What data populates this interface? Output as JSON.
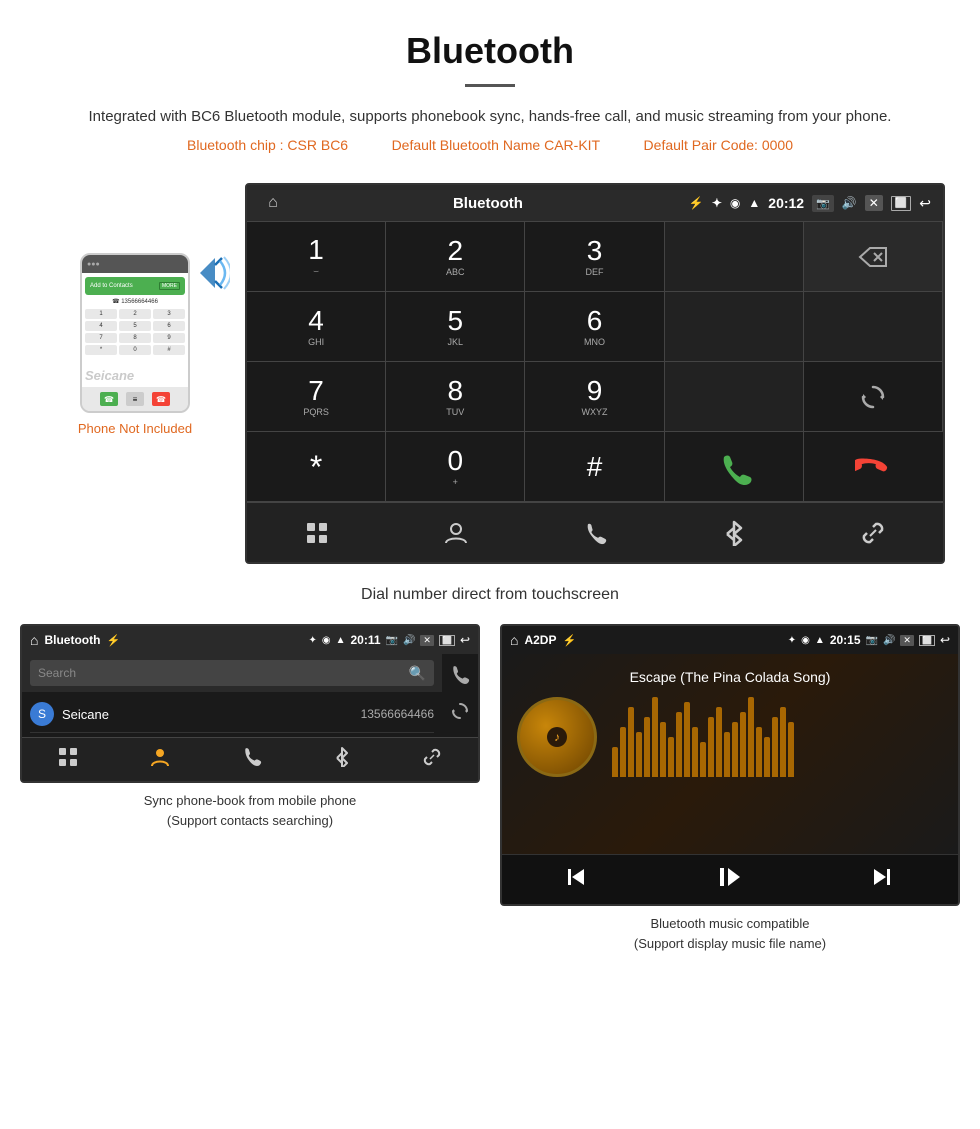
{
  "page": {
    "title": "Bluetooth",
    "divider": true,
    "description": "Integrated with BC6 Bluetooth module, supports phonebook sync, hands-free call, and music streaming from your phone.",
    "specs": {
      "chip": "Bluetooth chip : CSR BC6",
      "name": "Default Bluetooth Name CAR-KIT",
      "code": "Default Pair Code: 0000"
    }
  },
  "big_screen": {
    "status_bar": {
      "app_name": "Bluetooth",
      "time": "20:12"
    },
    "dialpad": {
      "keys": [
        {
          "num": "1",
          "sub": "⌣"
        },
        {
          "num": "2",
          "sub": "ABC"
        },
        {
          "num": "3",
          "sub": "DEF"
        },
        {
          "num": "",
          "sub": ""
        },
        {
          "num": "⌫",
          "sub": ""
        },
        {
          "num": "4",
          "sub": "GHI"
        },
        {
          "num": "5",
          "sub": "JKL"
        },
        {
          "num": "6",
          "sub": "MNO"
        },
        {
          "num": "",
          "sub": ""
        },
        {
          "num": "",
          "sub": ""
        },
        {
          "num": "7",
          "sub": "PQRS"
        },
        {
          "num": "8",
          "sub": "TUV"
        },
        {
          "num": "9",
          "sub": "WXYZ"
        },
        {
          "num": "",
          "sub": ""
        },
        {
          "num": "↺",
          "sub": ""
        },
        {
          "num": "*",
          "sub": ""
        },
        {
          "num": "0",
          "sub": "+"
        },
        {
          "num": "#",
          "sub": ""
        },
        {
          "num": "📞",
          "sub": ""
        },
        {
          "num": "📞end",
          "sub": ""
        }
      ]
    },
    "caption": "Dial number direct from touchscreen"
  },
  "phone": {
    "not_included_text": "Phone Not Included"
  },
  "bottom_left": {
    "status_bar": {
      "app_name": "Bluetooth",
      "time": "20:11"
    },
    "search_placeholder": "Search",
    "contacts": [
      {
        "initial": "S",
        "name": "Seicane",
        "number": "13566664466"
      }
    ],
    "caption_line1": "Sync phone-book from mobile phone",
    "caption_line2": "(Support contacts searching)"
  },
  "bottom_right": {
    "status_bar": {
      "app_name": "A2DP",
      "time": "20:15"
    },
    "track_title": "Escape (The Pina Colada Song)",
    "visualizer_bars": [
      30,
      50,
      70,
      45,
      60,
      80,
      55,
      40,
      65,
      75,
      50,
      35,
      60,
      70,
      45,
      55,
      65,
      80,
      50,
      40,
      60,
      70,
      55
    ],
    "caption_line1": "Bluetooth music compatible",
    "caption_line2": "(Support display music file name)"
  },
  "icons": {
    "home": "⌂",
    "usb": "⚡",
    "bluetooth": "✦",
    "location": "◉",
    "wifi": "▲",
    "camera": "⬛",
    "volume": "◁)",
    "close": "✕",
    "window": "⬜",
    "back": "↩",
    "grid": "⊞",
    "person": "☺",
    "phone": "☎",
    "refresh": "↺",
    "link": "🔗",
    "search": "⌕",
    "prev": "⏮",
    "play_pause": "⏯",
    "next": "⏭"
  }
}
